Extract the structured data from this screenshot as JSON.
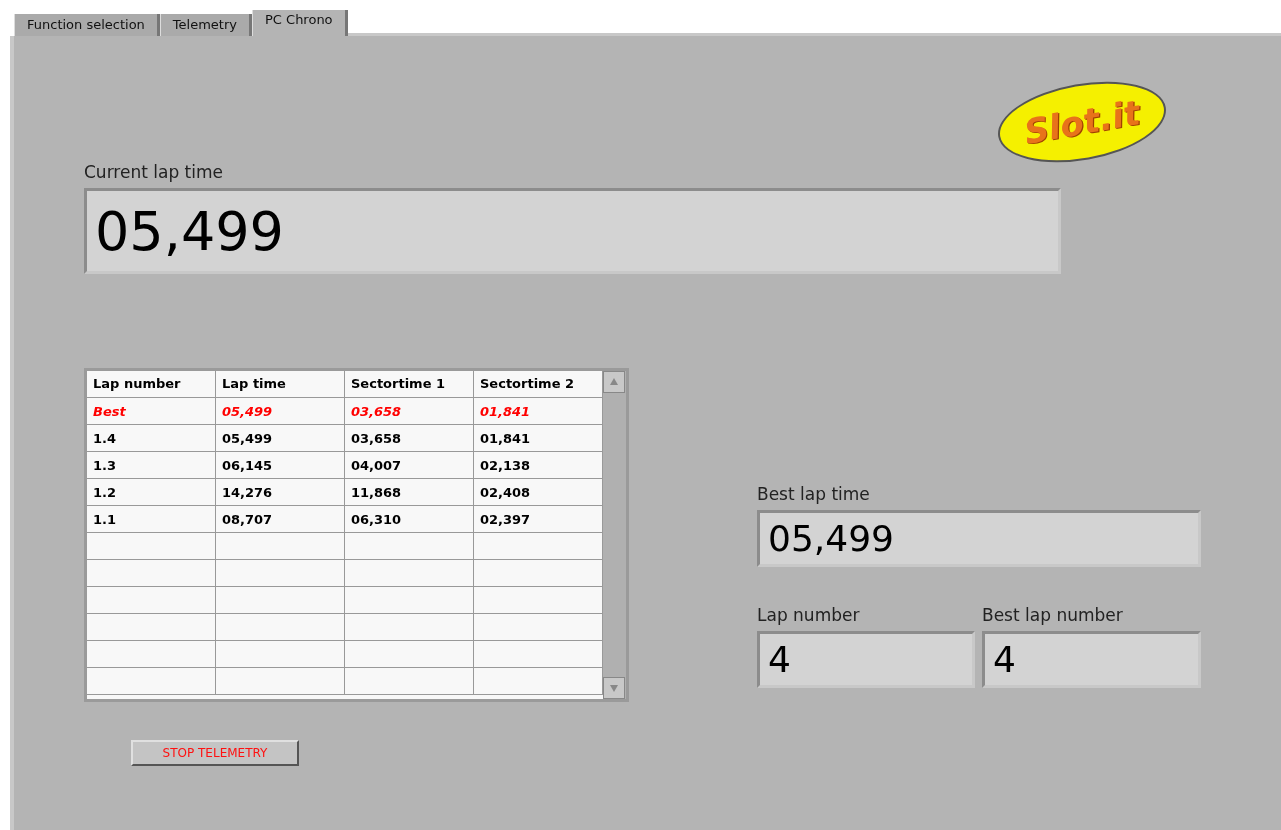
{
  "tabs": [
    {
      "label": "Function selection",
      "selected": false
    },
    {
      "label": "Telemetry",
      "selected": false
    },
    {
      "label": "PC Chrono",
      "selected": true
    }
  ],
  "logo": {
    "text": "Slot.it"
  },
  "current_lap_time": {
    "label": "Current lap time",
    "value": "05,499"
  },
  "table": {
    "columns": [
      "Lap number",
      "Lap time",
      "Sectortime 1",
      "Sectortime 2"
    ],
    "rows": [
      {
        "kind": "best",
        "cells": [
          "Best",
          "05,499",
          "03,658",
          "01,841"
        ]
      },
      {
        "kind": "lap",
        "cells": [
          "1.4",
          "05,499",
          "03,658",
          "01,841"
        ]
      },
      {
        "kind": "lap",
        "cells": [
          "1.3",
          "06,145",
          "04,007",
          "02,138"
        ]
      },
      {
        "kind": "lap",
        "cells": [
          "1.2",
          "14,276",
          "11,868",
          "02,408"
        ]
      },
      {
        "kind": "lap",
        "cells": [
          "1.1",
          "08,707",
          "06,310",
          "02,397"
        ]
      }
    ]
  },
  "best_lap_time": {
    "label": "Best lap time",
    "value": "05,499"
  },
  "lap_number": {
    "label": "Lap number",
    "value": "4"
  },
  "best_lap_number": {
    "label": "Best lap number",
    "value": "4"
  },
  "stop_button": {
    "label": "STOP TELEMETRY"
  }
}
